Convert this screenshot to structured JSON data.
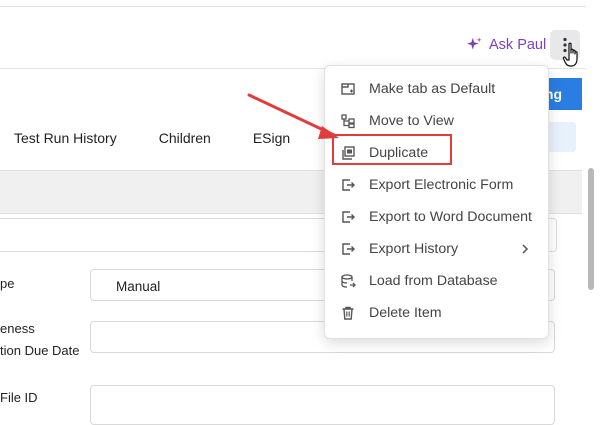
{
  "header": {
    "ask_paul_label": "Ask Paul"
  },
  "tabs": [
    "Test Run History",
    "Children",
    "ESign"
  ],
  "primary_button_label": "ng",
  "form": {
    "fields": [
      {
        "label_lines": [
          "pe"
        ],
        "value": "Manual"
      },
      {
        "label_lines": [
          "eness",
          "tion Due Date"
        ],
        "value": ""
      },
      {
        "label_lines": [
          "File ID"
        ],
        "value": ""
      }
    ]
  },
  "menu": {
    "items": [
      {
        "label": "Make tab as Default",
        "icon": "tab-default-icon"
      },
      {
        "label": "Move to View",
        "icon": "move-view-icon"
      },
      {
        "label": "Duplicate",
        "icon": "duplicate-icon"
      },
      {
        "label": "Export Electronic Form",
        "icon": "export-icon"
      },
      {
        "label": "Export to Word Document",
        "icon": "export-icon"
      },
      {
        "label": "Export History",
        "icon": "export-icon",
        "has_submenu": true
      },
      {
        "label": "Load from Database",
        "icon": "database-icon"
      },
      {
        "label": "Delete Item",
        "icon": "trash-icon"
      }
    ]
  },
  "colors": {
    "accent_purple": "#7b3fbf",
    "primary_blue": "#2a7de1",
    "annotation_red": "#e23b3b"
  }
}
